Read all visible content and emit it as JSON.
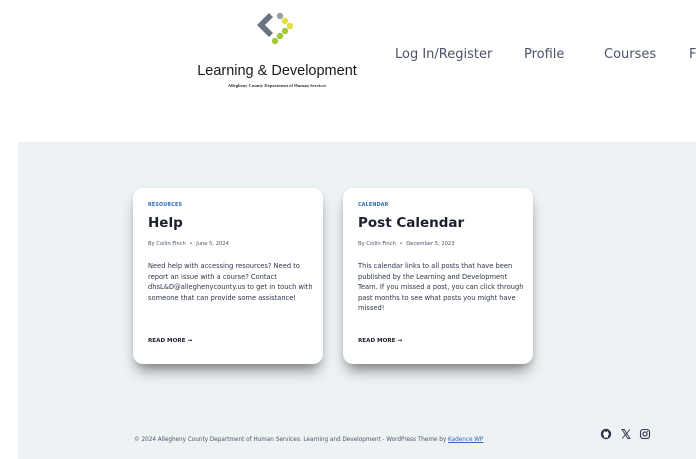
{
  "header": {
    "logo_title": "Learning & Development",
    "logo_subtitle": "Allegheny County Department of Human Services",
    "logo_colors": [
      "#6b7280",
      "#a3c93a",
      "#e6e03a",
      "#9aa0a6"
    ]
  },
  "nav": {
    "items": [
      "Log In/Register",
      "Profile",
      "Courses",
      "F"
    ]
  },
  "cards": [
    {
      "category": "RESOURCES",
      "title": "Help",
      "author": "By Collin Finch",
      "separator": "•",
      "date": "June 5, 2024",
      "excerpt": "Need help with accessing resources? Need to report an issue with a course? Contact dhsL&D@alleghenycounty.us to get in touch with someone that can provide some assistance!",
      "read_more": "READ MORE →"
    },
    {
      "category": "CALENDAR",
      "title": "Post Calendar",
      "author": "By Collin Finch",
      "separator": "•",
      "date": "December 5, 2023",
      "excerpt": "This calendar links to all posts that have been published by the Learning and Development Team. If you missed a post, you can click through past months to see what posts you might have missed!",
      "read_more": "READ MORE →"
    }
  ],
  "footer": {
    "text": "© 2024 Allegheny County Department of Human Services: Learning and Development - WordPress Theme by ",
    "link": "Kadence WP",
    "social_icons": [
      "github-icon",
      "x-icon",
      "instagram-icon"
    ]
  }
}
